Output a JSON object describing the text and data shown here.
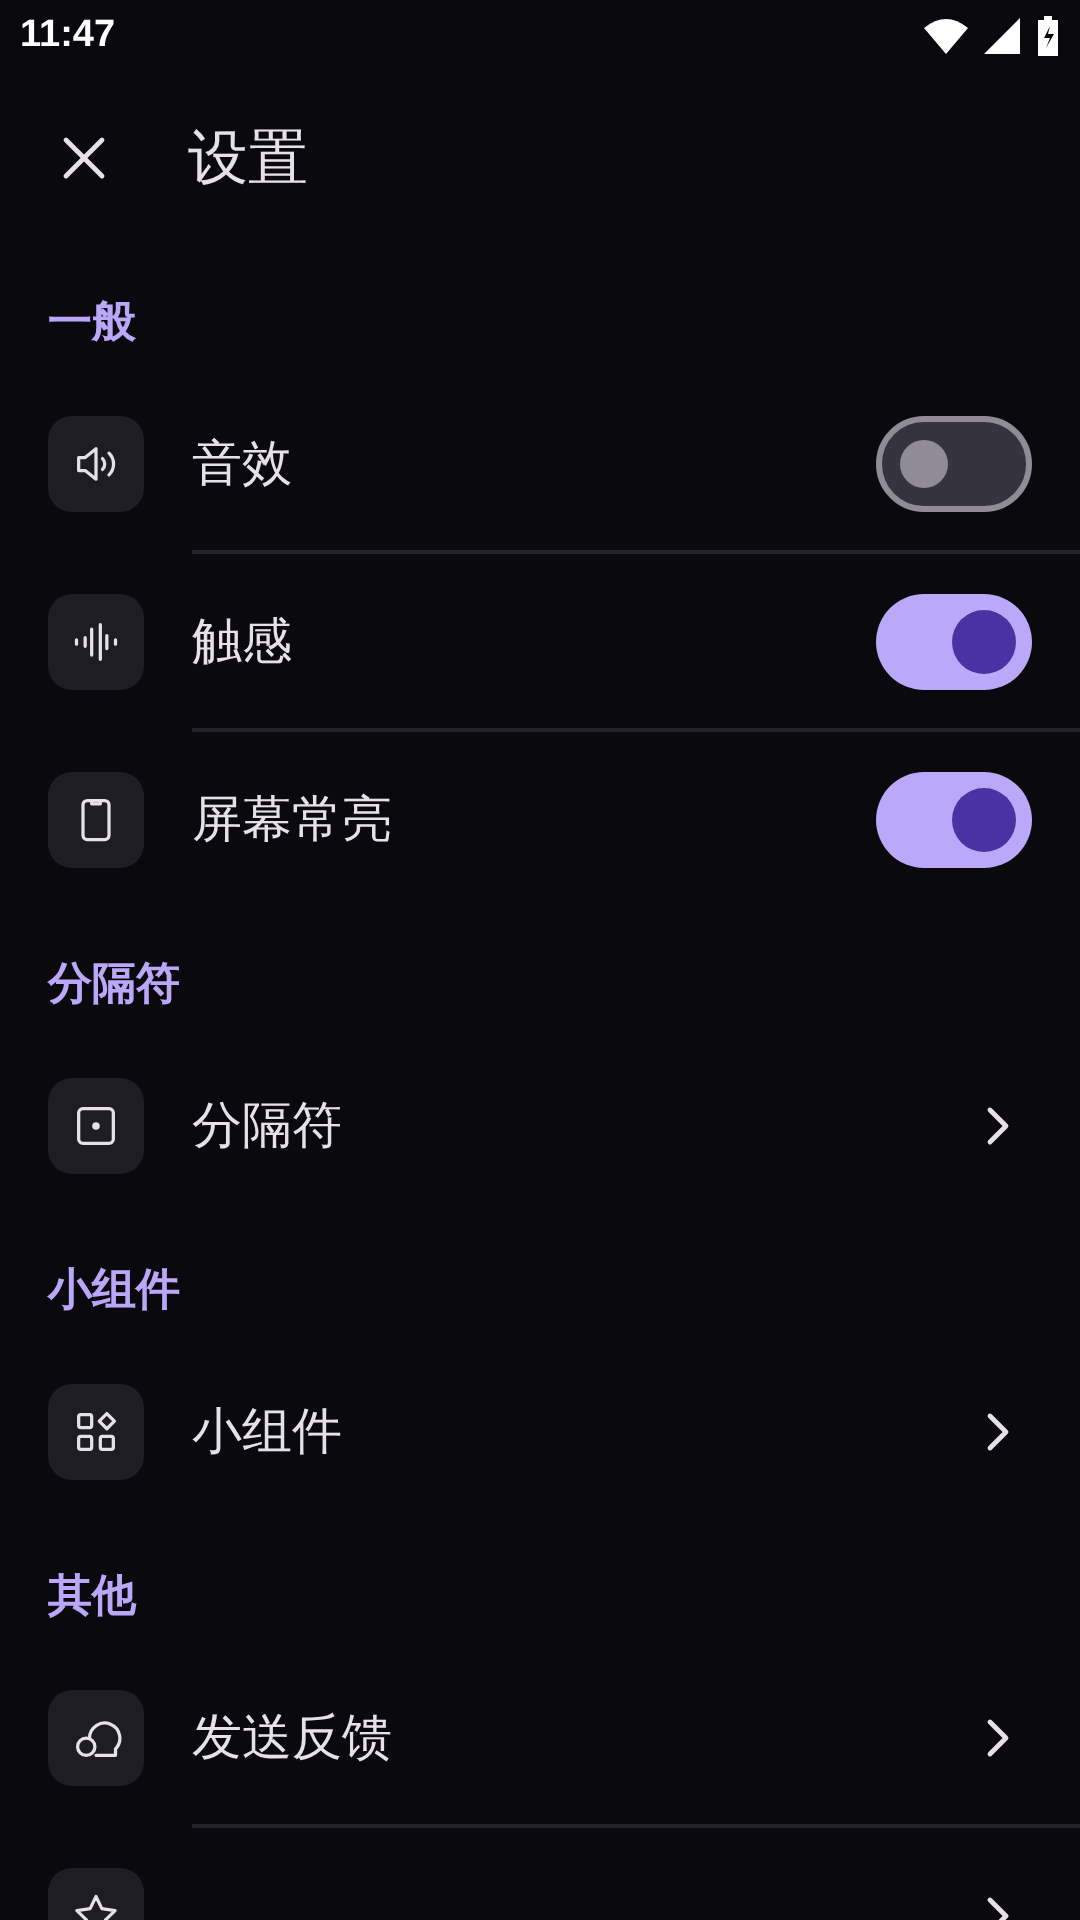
{
  "status_bar": {
    "time": "11:47"
  },
  "top_bar": {
    "title": "设置"
  },
  "sections": [
    {
      "title": "一般",
      "items": [
        {
          "label": "音效",
          "kind": "toggle",
          "on": false
        },
        {
          "label": "触感",
          "kind": "toggle",
          "on": true
        },
        {
          "label": "屏幕常亮",
          "kind": "toggle",
          "on": true
        }
      ]
    },
    {
      "title": "分隔符",
      "items": [
        {
          "label": "分隔符",
          "kind": "link"
        }
      ]
    },
    {
      "title": "小组件",
      "items": [
        {
          "label": "小组件",
          "kind": "link"
        }
      ]
    },
    {
      "title": "其他",
      "items": [
        {
          "label": "发送反馈",
          "kind": "link"
        },
        {
          "kind": "link"
        }
      ]
    }
  ]
}
